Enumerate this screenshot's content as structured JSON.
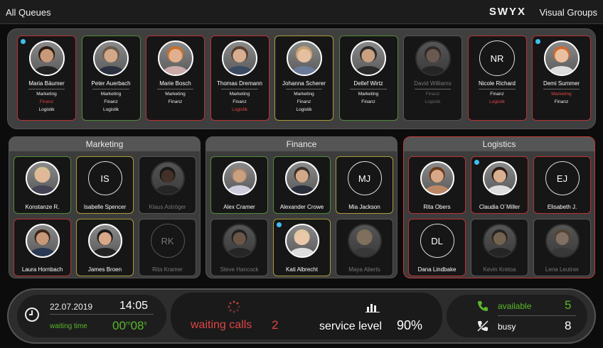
{
  "header": {
    "title": "All Queues",
    "logo_text": "SWYX",
    "brand_sub": "Visual Groups"
  },
  "colors": {
    "accent_red": "#e04444",
    "accent_green": "#5ab82a",
    "available_dot": "#3fc0f0"
  },
  "top_agents": [
    {
      "name": "Maria Bäumer",
      "skills": [
        {
          "t": "Marketing",
          "s": "n"
        },
        {
          "t": "Finanz",
          "s": "r"
        },
        {
          "t": "Logistik",
          "s": "n"
        }
      ],
      "border": "red",
      "dot": true,
      "photo": {
        "skin": "#c89a7a",
        "hair": "#2a1a12",
        "shirt": "#222"
      }
    },
    {
      "name": "Peter Auerbach",
      "skills": [
        {
          "t": "Marketing",
          "s": "n"
        },
        {
          "t": "Finanz",
          "s": "n"
        },
        {
          "t": "Logistik",
          "s": "n"
        }
      ],
      "border": "green",
      "dot": false,
      "photo": {
        "skin": "#d2a888",
        "hair": "#6a5a4a",
        "shirt": "#2b3140"
      }
    },
    {
      "name": "Marie Bosch",
      "skills": [
        {
          "t": "Marketing",
          "s": "n"
        },
        {
          "t": "Finanz",
          "s": "n"
        }
      ],
      "border": "red",
      "dot": false,
      "photo": {
        "skin": "#e0b090",
        "hair": "#c8702a",
        "shirt": "#caa"
      }
    },
    {
      "name": "Thomas Dremann",
      "skills": [
        {
          "t": "Marketing",
          "s": "n"
        },
        {
          "t": "Finanz",
          "s": "n"
        },
        {
          "t": "Logistik",
          "s": "r"
        }
      ],
      "border": "red",
      "dot": false,
      "photo": {
        "skin": "#d8ae90",
        "hair": "#5a4030",
        "shirt": "#3a4a60"
      }
    },
    {
      "name": "Johanna Scherer",
      "skills": [
        {
          "t": "Marketing",
          "s": "n"
        },
        {
          "t": "Finanz",
          "s": "n"
        },
        {
          "t": "Logistik",
          "s": "n"
        }
      ],
      "border": "yellow",
      "dot": false,
      "photo": {
        "skin": "#e4c0a0",
        "hair": "#c8a070",
        "shirt": "#6a7a99"
      }
    },
    {
      "name": "Detlef Wirtz",
      "skills": [
        {
          "t": "Marketing",
          "s": "n"
        },
        {
          "t": "Finanz",
          "s": "n"
        }
      ],
      "border": "green",
      "dot": false,
      "photo": {
        "skin": "#caa080",
        "hair": "#2a2a2a",
        "shirt": "#2a2a2a"
      }
    },
    {
      "name": "David Williams",
      "skills": [
        {
          "t": "Finanz",
          "s": "o"
        },
        {
          "t": "Logistik",
          "s": "o"
        }
      ],
      "border": "grey",
      "dot": false,
      "off": true,
      "photo": {
        "skin": "#b09080",
        "hair": "#4a3a30",
        "shirt": "#333"
      }
    },
    {
      "name": "Nicole Richard",
      "initials": "NR",
      "skills": [
        {
          "t": "Finanz",
          "s": "n"
        },
        {
          "t": "Logistik",
          "s": "r"
        }
      ],
      "border": "red",
      "dot": false
    },
    {
      "name": "Demi Summer",
      "skills": [
        {
          "t": "Marketing",
          "s": "r"
        },
        {
          "t": "Finanz",
          "s": "n"
        }
      ],
      "border": "red",
      "dot": true,
      "photo": {
        "skin": "#e8c0a0",
        "hair": "#d06a30",
        "shirt": "#ddd"
      }
    }
  ],
  "groups": [
    {
      "title": "Marketing",
      "agents": [
        {
          "name": "Konstanze R.",
          "border": "green",
          "photo": {
            "skin": "#e0b898",
            "hair": "#d8c090",
            "shirt": "#445"
          }
        },
        {
          "name": "Isabelle Spencer",
          "initials": "IS",
          "border": "yellow"
        },
        {
          "name": "Klaus Aströger",
          "border": "grey",
          "off": true,
          "photo": {
            "skin": "#6a4a38",
            "hair": "#1a1a1a",
            "shirt": "#333"
          }
        },
        {
          "name": "Laura Hornbach",
          "border": "red",
          "photo": {
            "skin": "#c8987a",
            "hair": "#3a2418",
            "shirt": "#2a3a55"
          }
        },
        {
          "name": "James Broen",
          "border": "yellow",
          "photo": {
            "skin": "#d8a888",
            "hair": "#1a1a1a",
            "shirt": "#222"
          }
        },
        {
          "name": "Rita Kramer",
          "initials": "RK",
          "border": "grey",
          "off": true
        }
      ]
    },
    {
      "title": "Finance",
      "agents": [
        {
          "name": "Alex Cramer",
          "border": "green",
          "photo": {
            "skin": "#caa07e",
            "hair": "#9a8070",
            "shirt": "#ccd"
          }
        },
        {
          "name": "Alexander Crowe",
          "border": "green",
          "photo": {
            "skin": "#d2a888",
            "hair": "#3a3028",
            "shirt": "#2a2e3a"
          }
        },
        {
          "name": "Mia Jackson",
          "initials": "MJ",
          "border": "yellow"
        },
        {
          "name": "Steve Hancock",
          "border": "grey",
          "off": true,
          "photo": {
            "skin": "#b08a70",
            "hair": "#2a2a2a",
            "shirt": "#333"
          }
        },
        {
          "name": "Kati Albrecht",
          "border": "yellow",
          "dot": true,
          "photo": {
            "skin": "#ecc8aa",
            "hair": "#e0c8a0",
            "shirt": "#ddd"
          }
        },
        {
          "name": "Maya Aberts",
          "border": "grey",
          "off": true,
          "photo": {
            "skin": "#d8b898",
            "hair": "#d0b890",
            "shirt": "#555"
          }
        }
      ]
    },
    {
      "title": "Logistics",
      "agents": [
        {
          "name": "Rita Obers",
          "border": "red",
          "photo": {
            "skin": "#d8a888",
            "hair": "#6a3a1a",
            "shirt": "#b86"
          }
        },
        {
          "name": "Claudia O´Miller",
          "border": "red",
          "dot": true,
          "photo": {
            "skin": "#d8b090",
            "hair": "#2a1a12",
            "shirt": "#ddd"
          }
        },
        {
          "name": "Elisabeth J.",
          "initials": "EJ",
          "border": "red"
        },
        {
          "name": "Dana Lindbake",
          "initials": "DL",
          "border": "red"
        },
        {
          "name": "Kevin Kretoa",
          "border": "grey",
          "off": true,
          "photo": {
            "skin": "#c0a080",
            "hair": "#3a3028",
            "shirt": "#333"
          }
        },
        {
          "name": "Lena Leutner",
          "border": "grey",
          "off": true,
          "photo": {
            "skin": "#d8b8a0",
            "hair": "#8a6a4a",
            "shirt": "#555"
          }
        }
      ]
    }
  ],
  "status": {
    "date": "22.07.2019",
    "time": "14:05",
    "waiting_time_label": "waiting time",
    "waiting_min": "00",
    "min_unit": "m",
    "waiting_sec": "08",
    "sec_unit": "s",
    "waiting_calls_label": "waiting calls",
    "waiting_calls": "2",
    "service_level_label": "service level",
    "service_level": "90%",
    "available_label": "available",
    "available": "5",
    "busy_label": "busy",
    "busy": "8",
    "icons": [
      "clock-icon",
      "spinner-icon",
      "bar-chart-icon",
      "phone-icon",
      "busy-phone-icon"
    ]
  }
}
